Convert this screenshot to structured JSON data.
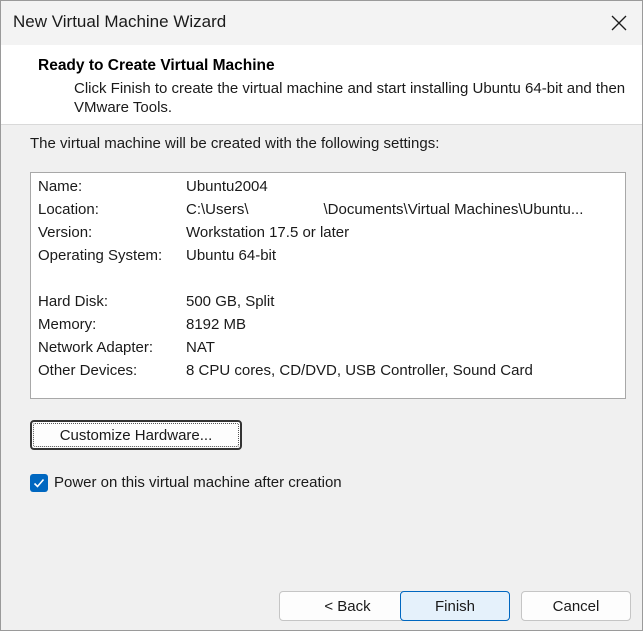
{
  "window": {
    "title": "New Virtual Machine Wizard"
  },
  "header": {
    "title": "Ready to Create Virtual Machine",
    "description": "Click Finish to create the virtual machine and start installing Ubuntu 64-bit and then VMware Tools."
  },
  "intro_text": "The virtual machine will be created with the following settings:",
  "settings": [
    {
      "label": "Name:",
      "value": "Ubuntu2004"
    },
    {
      "label": "Location:",
      "value": "C:\\Users\\                  \\Documents\\Virtual Machines\\Ubuntu..."
    },
    {
      "label": "Version:",
      "value": "Workstation 17.5 or later"
    },
    {
      "label": "Operating System:",
      "value": "Ubuntu 64-bit"
    },
    {
      "label": "Hard Disk:",
      "value": "500 GB, Split"
    },
    {
      "label": "Memory:",
      "value": "8192 MB"
    },
    {
      "label": "Network Adapter:",
      "value": "NAT"
    },
    {
      "label": "Other Devices:",
      "value": "8 CPU cores, CD/DVD, USB Controller, Sound Card"
    }
  ],
  "customize_button": "Customize Hardware...",
  "power_on": {
    "label": "Power on this virtual machine after creation",
    "checked": true
  },
  "footer": {
    "back": "< Back",
    "finish": "Finish",
    "cancel": "Cancel"
  },
  "colors": {
    "accent": "#0067c0",
    "dialog_bg": "#f0f0f0",
    "header_bg": "#ffffff"
  },
  "icons": {
    "close": "close-icon",
    "check": "checkmark-icon"
  }
}
